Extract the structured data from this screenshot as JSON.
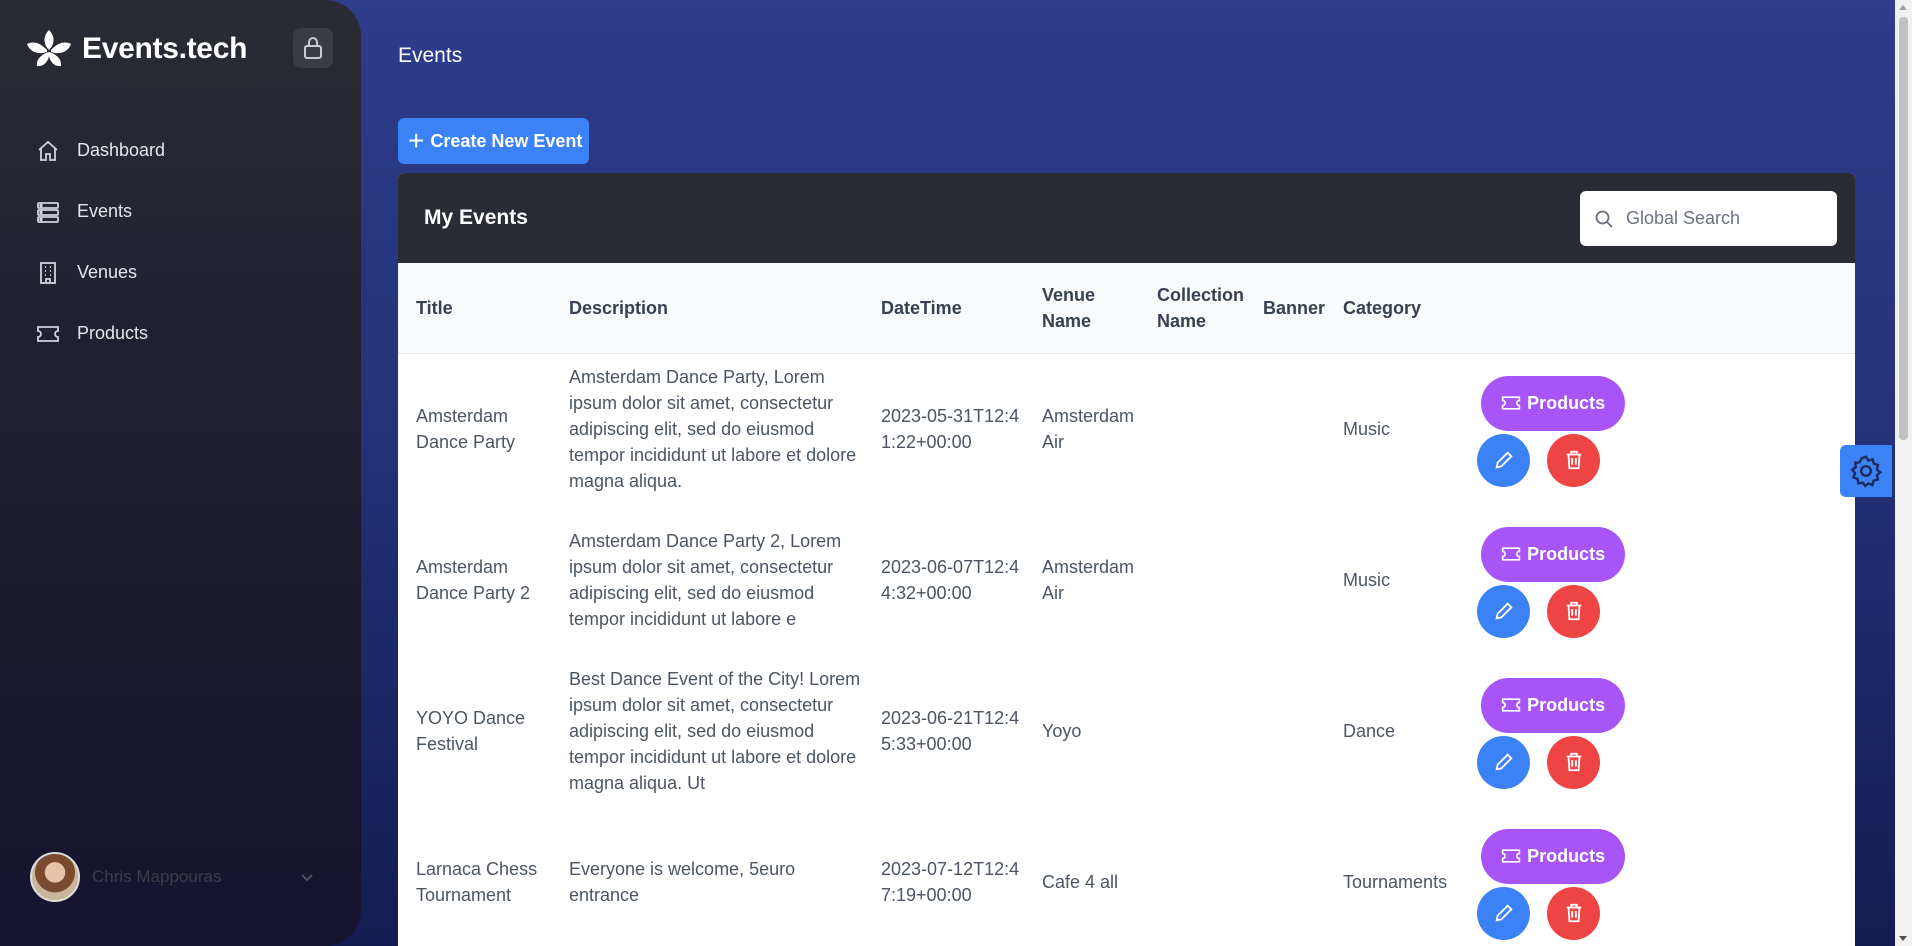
{
  "brand": {
    "name": "Events.tech"
  },
  "sidebar": {
    "items": [
      {
        "label": "Dashboard",
        "icon": "home-icon"
      },
      {
        "label": "Events",
        "icon": "server-list-icon"
      },
      {
        "label": "Venues",
        "icon": "building-icon"
      },
      {
        "label": "Products",
        "icon": "ticket-icon"
      }
    ],
    "user": {
      "name": "Chris Mappouras"
    }
  },
  "page": {
    "title": "Events"
  },
  "toolbar": {
    "create_label": "Create New Event",
    "create_icon": "+"
  },
  "card": {
    "title": "My Events",
    "search": {
      "placeholder": "Global Search",
      "value": ""
    }
  },
  "table": {
    "columns": {
      "title": "Title",
      "description": "Description",
      "datetime": "DateTime",
      "venue": "Venue Name",
      "collection": "Collection Name",
      "banner": "Banner",
      "category": "Category"
    },
    "rows": [
      {
        "title": "Amsterdam Dance Party",
        "description": "Amsterdam Dance Party, Lorem ipsum dolor sit amet, consectetur adipiscing elit, sed do eiusmod tempor incididunt ut labore et dolore magna aliqua.",
        "datetime": "2023-05-31T12:41:22+00:00",
        "venue": "Amsterdam Air",
        "collection": "",
        "banner": "",
        "category": "Music",
        "products_label": "Products"
      },
      {
        "title": "Amsterdam Dance Party 2",
        "description": "Amsterdam Dance Party 2, Lorem ipsum dolor sit amet, consectetur adipiscing elit, sed do eiusmod tempor incididunt ut labore e",
        "datetime": "2023-06-07T12:44:32+00:00",
        "venue": "Amsterdam Air",
        "collection": "",
        "banner": "",
        "category": "Music",
        "products_label": "Products"
      },
      {
        "title": "YOYO Dance Festival",
        "description": "Best Dance Event of the City! Lorem ipsum dolor sit amet, consectetur adipiscing elit, sed do eiusmod tempor incididunt ut labore et dolore magna aliqua. Ut",
        "datetime": "2023-06-21T12:45:33+00:00",
        "venue": "Yoyo",
        "collection": "",
        "banner": "",
        "category": "Dance",
        "products_label": "Products"
      },
      {
        "title": "Larnaca Chess Tournament",
        "description": "Everyone is welcome, 5euro entrance",
        "datetime": "2023-07-12T12:47:19+00:00",
        "venue": "Cafe 4 all",
        "collection": "",
        "banner": "",
        "category": "Tournaments",
        "products_label": "Products"
      }
    ]
  },
  "colors": {
    "accent": "#3b82f6",
    "products": "#a855f7",
    "delete": "#ef4444",
    "sidebar": "#2a2c33",
    "card_header": "#2a2c33"
  }
}
